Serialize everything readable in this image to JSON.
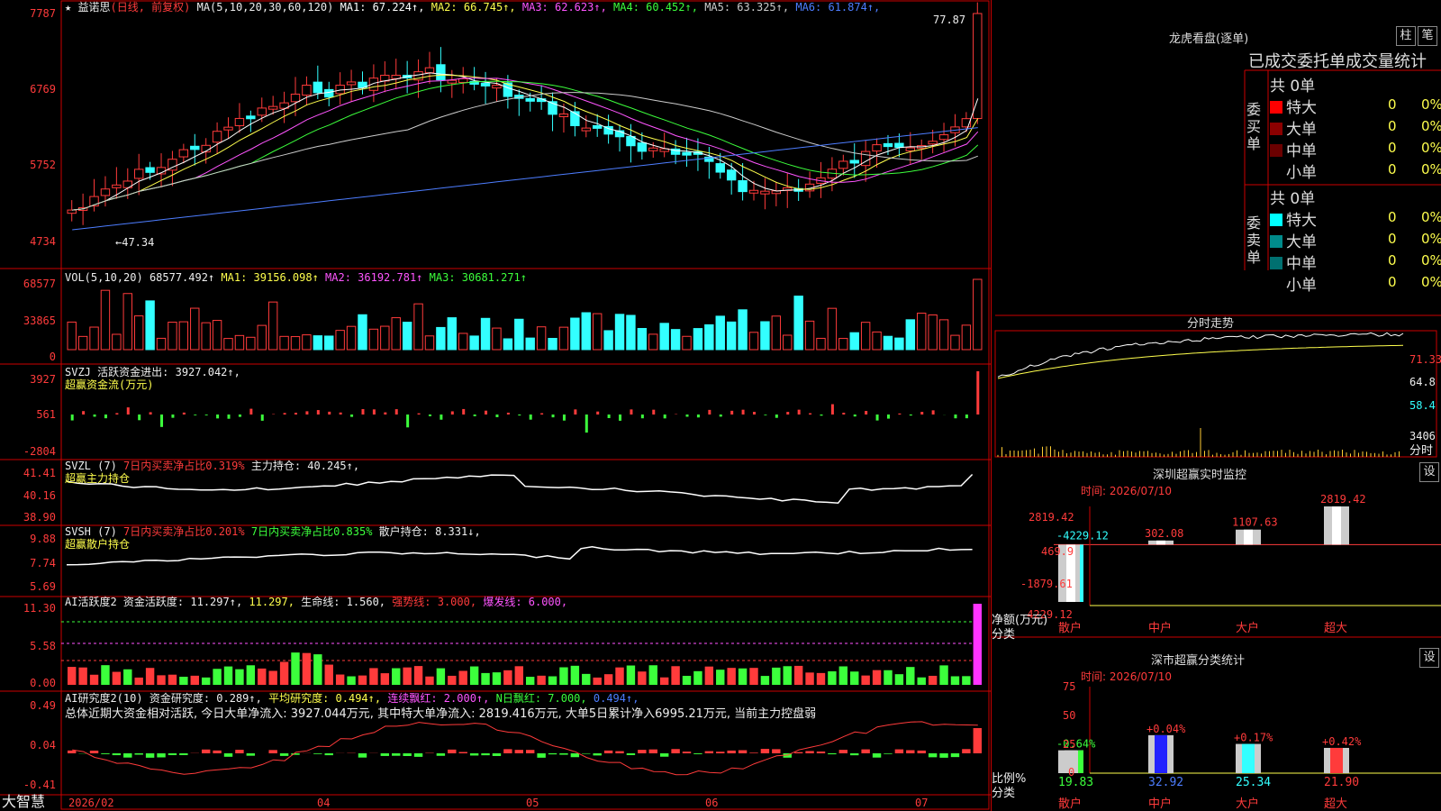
{
  "stock": {
    "name": "益诺思",
    "mode": "(日线, 前复权)",
    "ma_label": "MA(5,10,20,30,60,120)",
    "ma": [
      {
        "name": "MA1",
        "value": "67.224",
        "arrow": "↑",
        "color": "#ffffff"
      },
      {
        "name": "MA2",
        "value": "66.745",
        "arrow": "↑",
        "color": "#ffff4d"
      },
      {
        "name": "MA3",
        "value": "62.623",
        "arrow": "↑",
        "color": "#ff55ff"
      },
      {
        "name": "MA4",
        "value": "60.452",
        "arrow": "↑",
        "color": "#3cff3c"
      },
      {
        "name": "MA5",
        "value": "63.325",
        "arrow": "↑",
        "color": "#cccccc"
      },
      {
        "name": "MA6",
        "value": "61.874",
        "arrow": "↑",
        "color": "#4d7dff"
      }
    ],
    "high_mark": "77.87",
    "low_mark": "47.34"
  },
  "main_axis": [
    "7787",
    "6769",
    "5752",
    "4734"
  ],
  "vol": {
    "label": "VOL(5,10,20)",
    "value": "68577.492↑",
    "ma1": "MA1: 39156.098↑",
    "ma2": "MA2: 36192.781↑",
    "ma3": "MA3: 30681.271↑",
    "axis": [
      "68577",
      "33865",
      "0"
    ]
  },
  "svzj": {
    "label": "SVZJ",
    "text": "活跃资金进出: 3927.042↑,",
    "sub": "超赢资金流(万元)",
    "axis": [
      "3927",
      "561",
      "-2804"
    ]
  },
  "svzl": {
    "label": "SVZL (7)",
    "ratio": "7日内买卖净占比0.319%",
    "hold": "主力持仓: 40.245↑,",
    "sub": "超赢主力持仓",
    "axis": [
      "41.41",
      "40.16",
      "38.90"
    ]
  },
  "svsh": {
    "label": "SVSH (7)",
    "ratio1": "7日内买卖净占比0.201%",
    "ratio2": "7日内买卖净占比0.835%",
    "hold": "散户持仓: 8.331↓,",
    "sub": "超赢散户持仓",
    "axis": [
      "9.88",
      "7.74",
      "5.69"
    ]
  },
  "ai1": {
    "label": "AI活跃度2",
    "t1": "资金活跃度: 11.297↑,",
    "t2": "11.297,",
    "t3": "生命线: 1.560,",
    "t4": "强势线: 3.000,",
    "t5": "爆发线: 6.000,",
    "axis": [
      "11.30",
      "5.58",
      "0.00"
    ]
  },
  "ai2": {
    "label": "AI研究度2(10)",
    "t1": "资金研究度: 0.289↑,",
    "t2": "平均研究度: 0.494↑,",
    "t3": "连续飘红: 2.000↑,",
    "t4": "N日飘红: 7.000,",
    "t5": "0.494↑,",
    "summary": "总体近期大资金相对活跃, 今日大单净流入: 3927.044万元, 其中特大单净流入: 2819.416万元, 大单5日累计净入6995.21万元, 当前主力控盘弱",
    "axis": [
      "0.49",
      "0.04",
      "-0.41"
    ]
  },
  "bottom": {
    "brand": "大智慧",
    "dates": [
      "2026/02",
      "04",
      "05",
      "06",
      "07"
    ]
  },
  "right": {
    "title": "龙虎看盘(逐单)",
    "btn1": "柱",
    "btn2": "笔",
    "subtitle": "已成交委托单成交量统计",
    "buy_group": "委买单",
    "sell_group": "委卖单",
    "buy_total": "共 0单",
    "sell_total": "共 0单",
    "buy_rows": [
      {
        "name": "特大",
        "count": "0",
        "pct": "0%",
        "color": "#ff0000"
      },
      {
        "name": "大单",
        "count": "0",
        "pct": "0%",
        "color": "#8b0000"
      },
      {
        "name": "中单",
        "count": "0",
        "pct": "0%",
        "color": "#6b0000"
      },
      {
        "name": "小单",
        "count": "0",
        "pct": "0%",
        "color": ""
      }
    ],
    "sell_rows": [
      {
        "name": "特大",
        "count": "0",
        "pct": "0%",
        "color": "#00ffff"
      },
      {
        "name": "大单",
        "count": "0",
        "pct": "0%",
        "color": "#008b8b"
      },
      {
        "name": "中单",
        "count": "0",
        "pct": "0%",
        "color": "#007070"
      },
      {
        "name": "小单",
        "count": "0",
        "pct": "0%",
        "color": ""
      }
    ],
    "intraday_title": "分时走势",
    "intraday_axis": [
      "71.33",
      "64.8",
      "58.4",
      "3406",
      "分时"
    ],
    "monitor_title": "深圳超赢实时监控",
    "monitor_btn": "设",
    "monitor_time": "时间: 2026/07/10",
    "monitor_axis": [
      "2819.42",
      "469.9",
      "-1879.61",
      "-4229.12"
    ],
    "monitor_label": "净额(万元)",
    "monitor_label2": "分类",
    "class_title": "深市超赢分类统计",
    "class_btn": "设",
    "class_time": "时间: 2026/07/10",
    "class_axis": [
      "75",
      "50",
      "25",
      "0"
    ],
    "class_label": "比例%",
    "class_label2": "分类"
  },
  "chart_data": [
    {
      "type": "bar",
      "title": "深圳超赢实时监控",
      "ylabel": "净额(万元)",
      "categories": [
        "散户",
        "中户",
        "大户",
        "超大"
      ],
      "values": [
        -4229.12,
        302.08,
        1107.63,
        2819.42
      ],
      "ylim": [
        -4229.12,
        2819.42
      ]
    },
    {
      "type": "bar",
      "title": "深市超赢分类统计",
      "ylabel": "比例%",
      "categories": [
        "散户",
        "中户",
        "大户",
        "超大"
      ],
      "values": [
        19.83,
        32.92,
        25.34,
        21.9
      ],
      "changes": [
        "-0.64%",
        "+0.04%",
        "+0.17%",
        "+0.42%"
      ],
      "ylim": [
        0,
        75
      ]
    }
  ]
}
